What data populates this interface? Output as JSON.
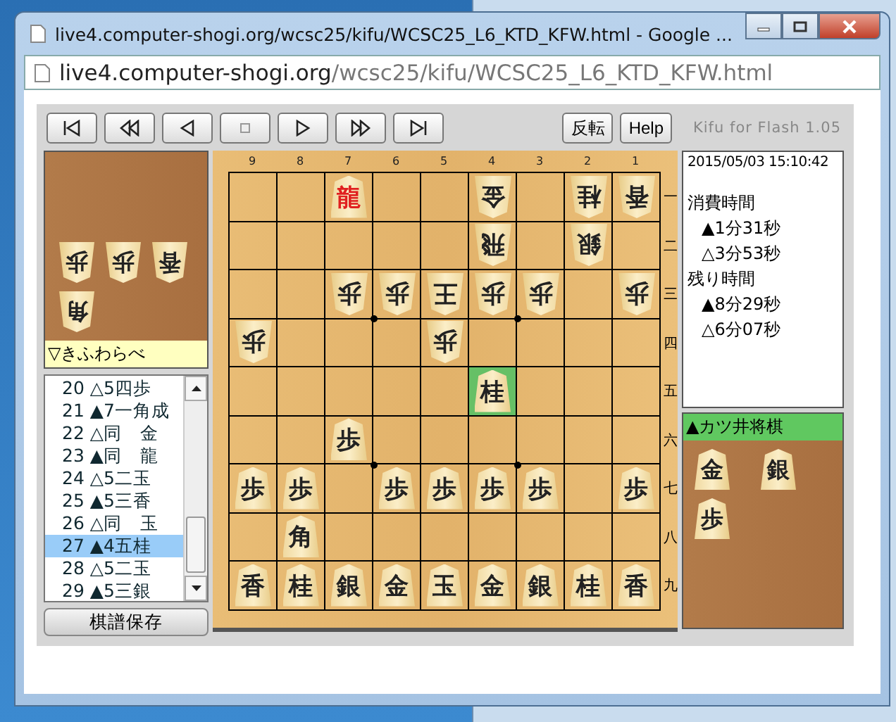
{
  "window": {
    "title": "live4.computer-shogi.org/wcsc25/kifu/WCSC25_L6_KTD_KFW.html - Google ..."
  },
  "address_bar": {
    "host": "live4.computer-shogi.org",
    "path": "/wcsc25/kifu/WCSC25_L6_KTD_KFW.html"
  },
  "toolbar": {
    "buttons": [
      "反転",
      "Help"
    ],
    "version": "Kifu for Flash 1.05"
  },
  "gote_hand": {
    "player": "▽きふわらべ",
    "pieces": [
      "歩",
      "歩",
      "香",
      "角"
    ]
  },
  "move_list": [
    {
      "number": "20",
      "move": "△5四歩",
      "selected": false
    },
    {
      "number": "21",
      "move": "▲7一角成",
      "selected": false
    },
    {
      "number": "22",
      "move": "△同　金",
      "selected": false
    },
    {
      "number": "23",
      "move": "▲同　龍",
      "selected": false
    },
    {
      "number": "24",
      "move": "△5二玉",
      "selected": false
    },
    {
      "number": "25",
      "move": "▲5三香",
      "selected": false
    },
    {
      "number": "26",
      "move": "△同　玉",
      "selected": false
    },
    {
      "number": "27",
      "move": "▲4五桂",
      "selected": true
    },
    {
      "number": "28",
      "move": "△5二玉",
      "selected": false
    },
    {
      "number": "29",
      "move": "▲5三銀",
      "selected": false
    }
  ],
  "save_button": "棋譜保存",
  "board": {
    "column_labels": [
      "9",
      "8",
      "7",
      "6",
      "5",
      "4",
      "3",
      "2",
      "1"
    ],
    "row_labels": [
      "一",
      "二",
      "三",
      "四",
      "五",
      "六",
      "七",
      "八",
      "九"
    ],
    "rows": [
      [
        null,
        null,
        {
          "label": "龍",
          "reversed": false,
          "promoted": true,
          "highlighted": false
        },
        null,
        null,
        {
          "label": "金",
          "reversed": true,
          "promoted": false,
          "highlighted": false
        },
        null,
        {
          "label": "桂",
          "reversed": true,
          "promoted": false,
          "highlighted": false
        },
        {
          "label": "香",
          "reversed": true,
          "promoted": false,
          "highlighted": false
        }
      ],
      [
        null,
        null,
        null,
        null,
        null,
        {
          "label": "飛",
          "reversed": true,
          "promoted": false,
          "highlighted": false
        },
        null,
        {
          "label": "銀",
          "reversed": true,
          "promoted": false,
          "highlighted": false
        },
        null
      ],
      [
        null,
        null,
        {
          "label": "歩",
          "reversed": true,
          "promoted": false,
          "highlighted": false
        },
        {
          "label": "歩",
          "reversed": true,
          "promoted": false,
          "highlighted": false
        },
        {
          "label": "王",
          "reversed": true,
          "promoted": false,
          "highlighted": false
        },
        {
          "label": "歩",
          "reversed": true,
          "promoted": false,
          "highlighted": false
        },
        {
          "label": "歩",
          "reversed": true,
          "promoted": false,
          "highlighted": false
        },
        null,
        {
          "label": "歩",
          "reversed": true,
          "promoted": false,
          "highlighted": false
        }
      ],
      [
        {
          "label": "歩",
          "reversed": true,
          "promoted": false,
          "highlighted": false
        },
        null,
        null,
        null,
        {
          "label": "歩",
          "reversed": true,
          "promoted": false,
          "highlighted": false
        },
        null,
        null,
        null,
        null
      ],
      [
        null,
        null,
        null,
        null,
        null,
        {
          "label": "桂",
          "reversed": false,
          "promoted": false,
          "highlighted": true
        },
        null,
        null,
        null
      ],
      [
        null,
        null,
        {
          "label": "歩",
          "reversed": false,
          "promoted": false,
          "highlighted": false
        },
        null,
        null,
        null,
        null,
        null,
        null
      ],
      [
        {
          "label": "歩",
          "reversed": false,
          "promoted": false,
          "highlighted": false
        },
        {
          "label": "歩",
          "reversed": false,
          "promoted": false,
          "highlighted": false
        },
        null,
        {
          "label": "歩",
          "reversed": false,
          "promoted": false,
          "highlighted": false
        },
        {
          "label": "歩",
          "reversed": false,
          "promoted": false,
          "highlighted": false
        },
        {
          "label": "歩",
          "reversed": false,
          "promoted": false,
          "highlighted": false
        },
        {
          "label": "歩",
          "reversed": false,
          "promoted": false,
          "highlighted": false
        },
        null,
        {
          "label": "歩",
          "reversed": false,
          "promoted": false,
          "highlighted": false
        }
      ],
      [
        null,
        {
          "label": "角",
          "reversed": false,
          "promoted": false,
          "highlighted": false
        },
        null,
        null,
        null,
        null,
        null,
        null,
        null
      ],
      [
        {
          "label": "香",
          "reversed": false,
          "promoted": false,
          "highlighted": false
        },
        {
          "label": "桂",
          "reversed": false,
          "promoted": false,
          "highlighted": false
        },
        {
          "label": "銀",
          "reversed": false,
          "promoted": false,
          "highlighted": false
        },
        {
          "label": "金",
          "reversed": false,
          "promoted": false,
          "highlighted": false
        },
        {
          "label": "玉",
          "reversed": false,
          "promoted": false,
          "highlighted": false
        },
        {
          "label": "金",
          "reversed": false,
          "promoted": false,
          "highlighted": false
        },
        {
          "label": "銀",
          "reversed": false,
          "promoted": false,
          "highlighted": false
        },
        {
          "label": "桂",
          "reversed": false,
          "promoted": false,
          "highlighted": false
        },
        {
          "label": "香",
          "reversed": false,
          "promoted": false,
          "highlighted": false
        }
      ]
    ]
  },
  "info": {
    "datetime": "2015/05/03 15:10:42",
    "lines": [
      {
        "kind": "heading",
        "text": "消費時間"
      },
      {
        "kind": "time",
        "text": "▲1分31秒"
      },
      {
        "kind": "time",
        "text": "△3分53秒"
      },
      {
        "kind": "heading",
        "text": "残り時間"
      },
      {
        "kind": "time",
        "text": "▲8分29秒"
      },
      {
        "kind": "time",
        "text": "△6分07秒"
      }
    ]
  },
  "sente_hand": {
    "player": "▲カツ井将棋",
    "to_move": true,
    "pieces": [
      "金",
      "銀",
      "歩"
    ]
  }
}
